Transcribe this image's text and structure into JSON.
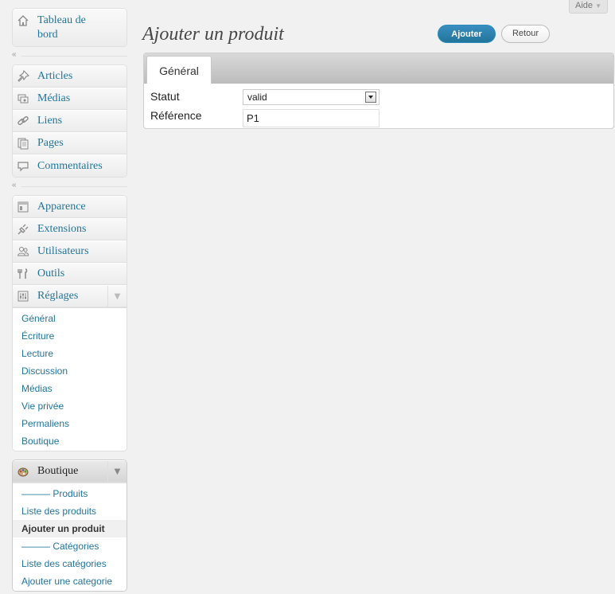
{
  "help": {
    "label": "Aide",
    "arrow": "▼"
  },
  "menu": {
    "dashboard": "Tableau de bord",
    "group1": [
      "Articles",
      "Médias",
      "Liens",
      "Pages",
      "Commentaires"
    ],
    "group2": [
      "Apparence",
      "Extensions",
      "Utilisateurs",
      "Outils",
      "Réglages"
    ],
    "collapse_glyph": "«",
    "reglages_sub": [
      "Général",
      "Écriture",
      "Lecture",
      "Discussion",
      "Médias",
      "Vie privée",
      "Permaliens",
      "Boutique"
    ],
    "boutique": {
      "label": "Boutique",
      "sub": [
        "——— Produits",
        "Liste des produits",
        "Ajouter un produit",
        "——— Catégories",
        "Liste des catégories",
        "Ajouter une categorie"
      ]
    },
    "toggle_glyph": "▼"
  },
  "page": {
    "title": "Ajouter un produit",
    "add_button": "Ajouter",
    "back_button": "Retour"
  },
  "form": {
    "tab": "Général",
    "status_label": "Statut",
    "status_value": "valid",
    "reference_label": "Référence",
    "reference_value": "P1"
  },
  "colors": {
    "link": "#21759b",
    "primary_button": "#21759b",
    "background": "#f1f1f1"
  }
}
